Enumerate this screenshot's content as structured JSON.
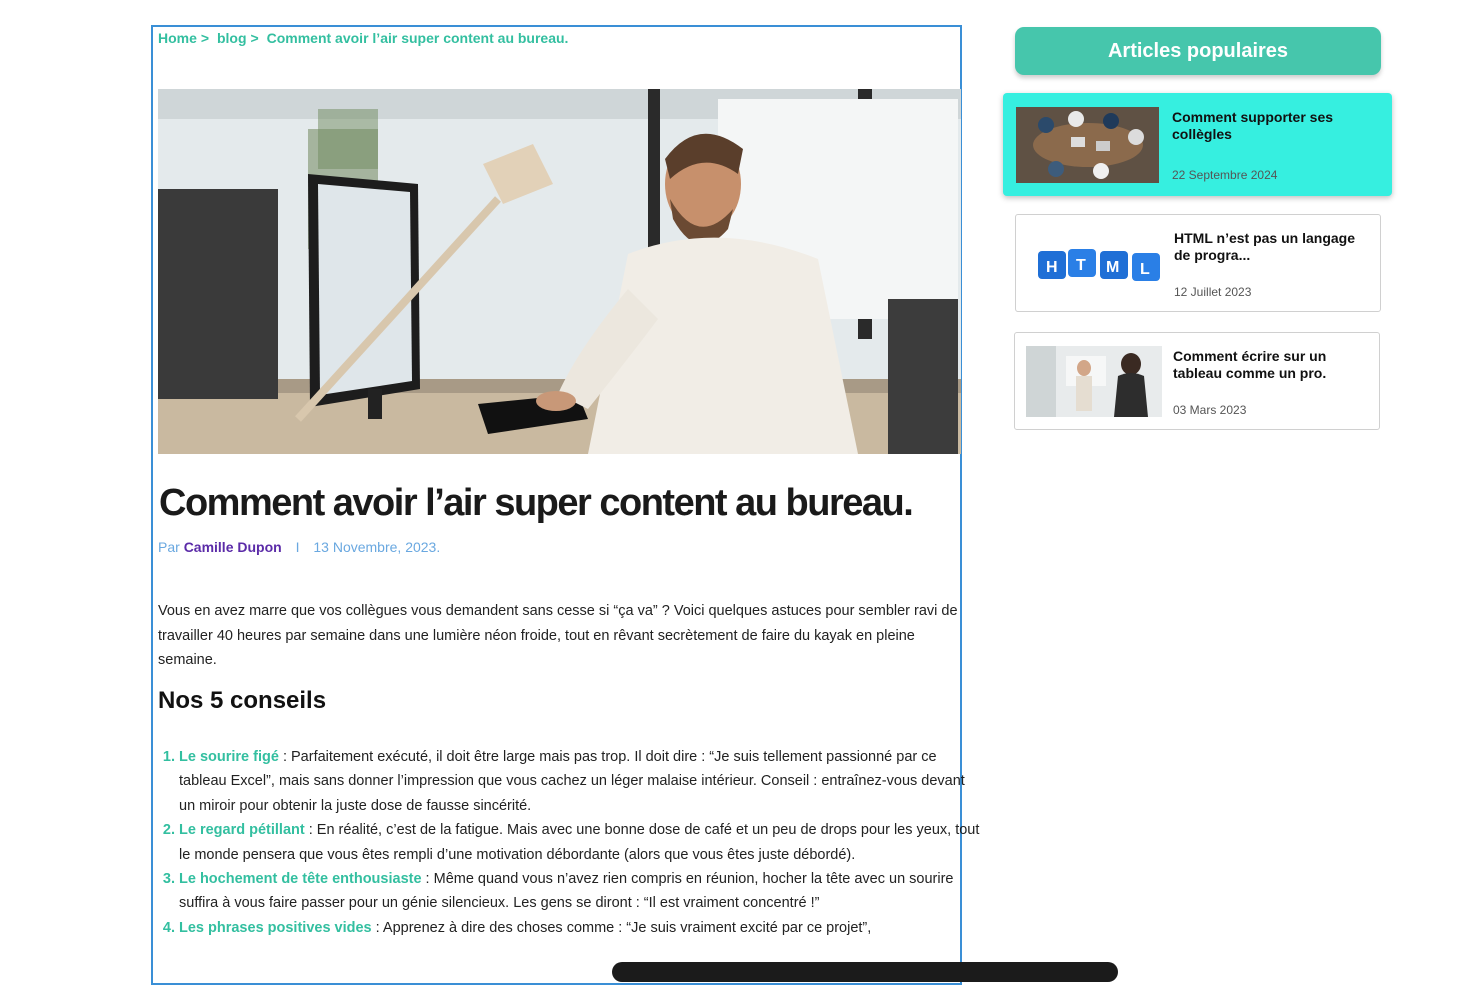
{
  "breadcrumb": {
    "home": "Home",
    "sep1": ">",
    "blog": "blog",
    "sep2": ">",
    "current": "Comment avoir l’air super content au bureau."
  },
  "article": {
    "title": "Comment avoir l’air super content au bureau.",
    "by_label": "Par",
    "author": "Camille Dupon",
    "meta_separator": "I",
    "date": "13 Novembre, 2023.",
    "intro": "Vous en avez marre que vos collègues vous demandent sans cesse si “ça va” ? Voici quelques astuces pour sembler ravi de travailler 40 heures par semaine dans une lumière néon froide, tout en rêvant secrètement de faire du kayak en pleine semaine.",
    "section_title": "Nos 5 conseils",
    "tips": [
      {
        "name": "Le sourire figé",
        "text": " : Parfaitement exécuté, il doit être large mais pas trop. Il doit dire : “Je suis tellement passionné par ce tableau Excel”, mais sans donner l’impression que vous cachez un léger malaise intérieur. Conseil : entraînez-vous devant un miroir pour obtenir la juste dose de fausse sincérité."
      },
      {
        "name": "Le regard pétillant",
        "text": " : En réalité, c’est de la fatigue. Mais avec une bonne dose de café et un peu de drops pour les yeux, tout le monde pensera que vous êtes rempli d’une motivation débordante (alors que vous êtes juste débordé)."
      },
      {
        "name": "Le hochement de tête enthousiaste",
        "text": " : Même quand vous n’avez rien compris en réunion, hocher la tête avec un sourire suffira à vous faire passer pour un génie silencieux. Les gens se diront : “Il est vraiment concentré !”"
      },
      {
        "name": "Les phrases positives vides",
        "text": " : Apprenez à dire des choses comme : “Je suis vraiment excité par ce projet”,"
      }
    ],
    "hero_icon": "office-man-at-computer-photo"
  },
  "sidebar": {
    "header": "Articles populaires",
    "cards": [
      {
        "title": "Comment supporter ses collègles",
        "date": "22 Septembre 2024",
        "thumb": "meeting-table-photo"
      },
      {
        "title": "HTML n’est pas un langage de progra...",
        "date": "12 Juillet 2023",
        "thumb": "html-blocks-photo"
      },
      {
        "title": "Comment écrire sur un tableau comme un pro.",
        "date": "03 Mars 2023",
        "thumb": "whiteboard-presentation-photo"
      }
    ]
  },
  "colors": {
    "accent": "#46c6ac",
    "active_card": "#36efe0",
    "author": "#5b2ba8",
    "meta": "#6aa8e0",
    "border": "#3a8fd6"
  }
}
